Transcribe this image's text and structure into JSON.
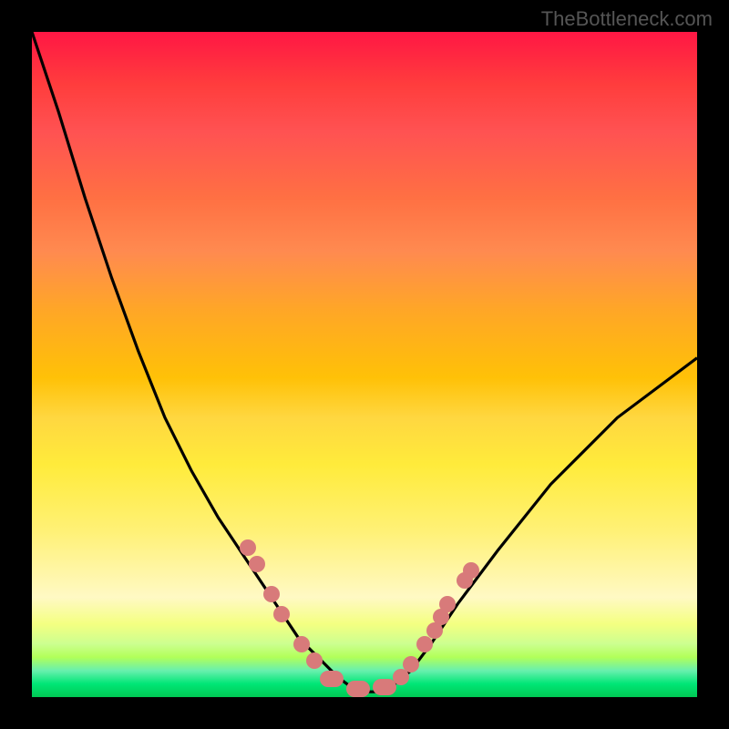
{
  "watermark": "TheBottleneck.com",
  "chart_data": {
    "type": "line",
    "title": "",
    "xlabel": "",
    "ylabel": "",
    "xlim": [
      0,
      100
    ],
    "ylim": [
      0,
      100
    ],
    "background": "rainbow-gradient-red-to-green",
    "series": [
      {
        "name": "curve",
        "x": [
          0,
          4,
          8,
          12,
          16,
          20,
          24,
          28,
          32,
          36,
          40,
          44,
          46,
          48,
          50,
          52,
          54,
          57,
          60,
          64,
          70,
          78,
          88,
          100
        ],
        "y": [
          100,
          88,
          75,
          63,
          52,
          42,
          34,
          27,
          21,
          15,
          9,
          5,
          3,
          1.5,
          0.8,
          0.8,
          1.5,
          4,
          8,
          14,
          22,
          32,
          42,
          51
        ],
        "color": "#000000"
      }
    ],
    "markers": [
      {
        "x": 32.5,
        "y": 22.5
      },
      {
        "x": 33.8,
        "y": 20.0
      },
      {
        "x": 36.0,
        "y": 15.5
      },
      {
        "x": 37.5,
        "y": 12.5
      },
      {
        "x": 40.5,
        "y": 8.0
      },
      {
        "x": 42.5,
        "y": 5.5
      },
      {
        "x": 45.0,
        "y": 2.8,
        "wide": true
      },
      {
        "x": 49.0,
        "y": 1.2,
        "wide": true
      },
      {
        "x": 53.0,
        "y": 1.5,
        "wide": true
      },
      {
        "x": 55.5,
        "y": 3.0
      },
      {
        "x": 57.0,
        "y": 5.0
      },
      {
        "x": 59.0,
        "y": 8.0
      },
      {
        "x": 60.5,
        "y": 10.0
      },
      {
        "x": 61.5,
        "y": 12.0
      },
      {
        "x": 62.5,
        "y": 14.0
      },
      {
        "x": 65.0,
        "y": 17.5
      },
      {
        "x": 66.0,
        "y": 19.0
      }
    ]
  }
}
